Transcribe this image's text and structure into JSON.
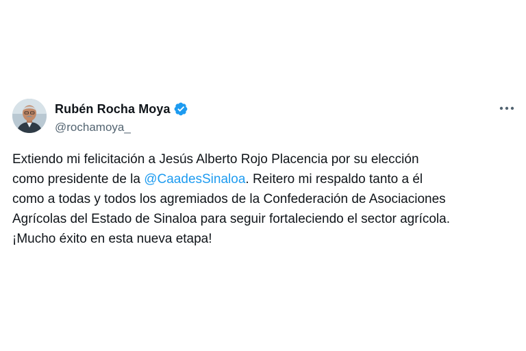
{
  "author": {
    "display_name": "Rubén Rocha Moya",
    "handle": "@rochamoya_",
    "verified": true,
    "verified_color": "#1d9bf0",
    "avatar_icon": "profile-photo"
  },
  "menu": {
    "more_icon": "ellipsis-icon"
  },
  "tweet": {
    "line1": "Extiendo mi felicitación a Jesús Alberto Rojo Placencia por su elección",
    "line2_before": "como presidente de la ",
    "mention": "@CaadesSinaloa",
    "line2_after": ". Reitero mi respaldo tanto a él",
    "line3": "como a todas y todos los agremiados de la Confederación de Asociaciones",
    "line4": "Agrícolas del Estado de Sinaloa para seguir fortaleciendo el sector agrícola.",
    "line5": "¡Mucho éxito en esta nueva etapa!",
    "mention_color": "#1d9bf0"
  }
}
